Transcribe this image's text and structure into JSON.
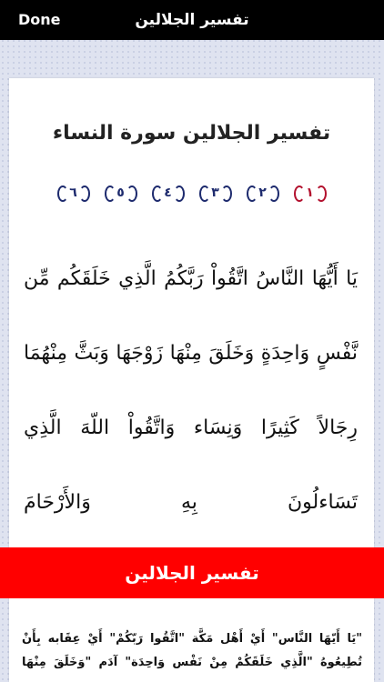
{
  "topbar": {
    "done_label": "Done",
    "title": "تفسير الجلالين"
  },
  "surah_title": "تفسير الجلالين سورة النساء",
  "verse_nav": [
    {
      "label": "١",
      "active": true
    },
    {
      "label": "٢",
      "active": false
    },
    {
      "label": "٣",
      "active": false
    },
    {
      "label": "٤",
      "active": false
    },
    {
      "label": "٥",
      "active": false
    },
    {
      "label": "٦",
      "active": false
    }
  ],
  "verse_text": "يَا أَيُّهَا النَّاسُ اتَّقُواْ رَبَّكُمُ الَّذِي خَلَقَكُم مِّن نَّفْسٍ وَاحِدَةٍ وَخَلَقَ مِنْهَا زَوْجَهَا وَبَثَّ مِنْهُمَا رِجَالاً كَثِيرًا وَنِسَاء وَاتَّقُواْ اللّهَ الَّذِي تَسَاءلُونَ بِهِ وَالأَرْحَامَ",
  "tafsir_header": "تفسير الجلالين",
  "tafsir_text": "\"يَا أَيّهَا النَّاس\" أَيْ أَهْل مَكَّة \"اتَّقُوا رَبّكُمْ\" أَيْ عِقَابه بِأَنْ تُطِيعُوهُ \"الَّذِي خَلَقَكُمْ مِنْ نَفْس وَاحِدَة\" آدَم \"وَخَلَقَ مِنْهَا",
  "colors": {
    "active_verse": "#b3122f",
    "verse_nav": "#1e2b6e",
    "tafsir_bar": "#ff0000"
  }
}
